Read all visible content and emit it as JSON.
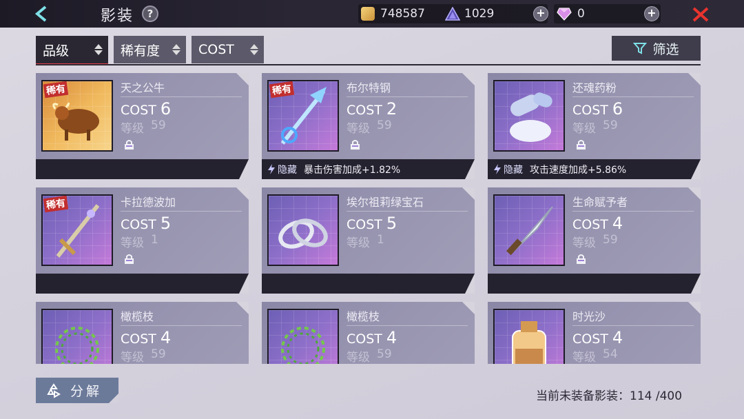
{
  "header": {
    "title": "影装",
    "help_label": "?",
    "gold": "748587",
    "crystal": "1029",
    "gems": "0",
    "plus_label": "+"
  },
  "sort": {
    "tabs": [
      {
        "label": "品级",
        "active": true
      },
      {
        "label": "稀有度",
        "active": false
      },
      {
        "label": "COST",
        "active": false
      }
    ],
    "filter_label": "筛选"
  },
  "cards": [
    {
      "name": "天之公牛",
      "cost_label": "COST",
      "cost": "6",
      "level_label": "等级",
      "level": "59",
      "rare": true,
      "rare_label": "稀有",
      "locked": true,
      "hidden_label": "",
      "hidden_text": "",
      "icon": "bull-icon",
      "theme": "gold"
    },
    {
      "name": "布尔特钢",
      "cost_label": "COST",
      "cost": "2",
      "level_label": "等级",
      "level": "59",
      "rare": true,
      "rare_label": "稀有",
      "locked": true,
      "hidden_label": "隐藏",
      "hidden_text": "暴击伤害加成+1.82%",
      "icon": "staff-icon",
      "theme": "purple"
    },
    {
      "name": "还魂药粉",
      "cost_label": "COST",
      "cost": "6",
      "level_label": "等级",
      "level": "59",
      "rare": false,
      "rare_label": "",
      "locked": true,
      "hidden_label": "隐藏",
      "hidden_text": "攻击速度加成+5.86%",
      "icon": "potion-capsule-icon",
      "theme": "purple"
    },
    {
      "name": "卡拉德波加",
      "cost_label": "COST",
      "cost": "5",
      "level_label": "等级",
      "level": "1",
      "rare": true,
      "rare_label": "稀有",
      "locked": true,
      "hidden_label": "",
      "hidden_text": "",
      "icon": "sword-icon",
      "theme": "purple"
    },
    {
      "name": "埃尔祖莉绿宝石",
      "cost_label": "COST",
      "cost": "5",
      "level_label": "等级",
      "level": "1",
      "rare": false,
      "rare_label": "",
      "locked": false,
      "hidden_label": "",
      "hidden_text": "",
      "icon": "rings-icon",
      "theme": "purple"
    },
    {
      "name": "生命赋予者",
      "cost_label": "COST",
      "cost": "4",
      "level_label": "等级",
      "level": "59",
      "rare": false,
      "rare_label": "",
      "locked": true,
      "hidden_label": "",
      "hidden_text": "",
      "icon": "knife-icon",
      "theme": "purple"
    },
    {
      "name": "橄榄枝",
      "cost_label": "COST",
      "cost": "4",
      "level_label": "等级",
      "level": "59",
      "rare": false,
      "rare_label": "",
      "locked": false,
      "hidden_label": "",
      "hidden_text": "",
      "icon": "laurel-wreath-icon",
      "theme": "purple"
    },
    {
      "name": "橄榄枝",
      "cost_label": "COST",
      "cost": "4",
      "level_label": "等级",
      "level": "59",
      "rare": false,
      "rare_label": "",
      "locked": false,
      "hidden_label": "",
      "hidden_text": "",
      "icon": "laurel-wreath-icon",
      "theme": "purple"
    },
    {
      "name": "时光沙",
      "cost_label": "COST",
      "cost": "4",
      "level_label": "等级",
      "level": "54",
      "rare": false,
      "rare_label": "",
      "locked": false,
      "hidden_label": "",
      "hidden_text": "",
      "icon": "sand-bottle-icon",
      "theme": "purple"
    }
  ],
  "footer": {
    "decompose_label": "分解",
    "capacity_text": "当前未装备影装：114 /400"
  }
}
